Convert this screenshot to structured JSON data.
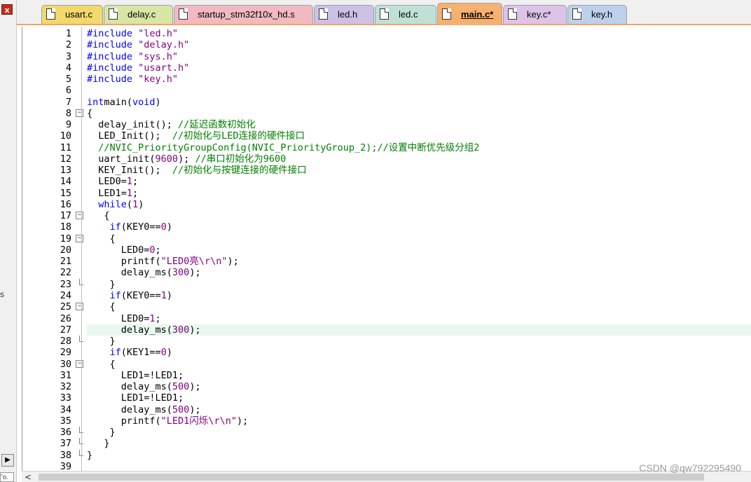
{
  "left_panel": {
    "close_glyph": "x",
    "fragment": "s",
    "scroll_button": "▶",
    "bottom_fragment": "ˆo."
  },
  "tabs": [
    {
      "label": "usart.c",
      "color": "#f1d96b",
      "active": false
    },
    {
      "label": "delay.c",
      "color": "#d7e6a4",
      "active": false
    },
    {
      "label": "startup_stm32f10x_hd.s",
      "color": "#f2b9c3",
      "active": false
    },
    {
      "label": "led.h",
      "color": "#cdc0e6",
      "active": false
    },
    {
      "label": "led.c",
      "color": "#bfe0d6",
      "active": false
    },
    {
      "label": "main.c*",
      "color": "#f6b070",
      "active": true
    },
    {
      "label": "key.c*",
      "color": "#ddc3e8",
      "active": false
    },
    {
      "label": "key.h",
      "color": "#bdd0ec",
      "active": false
    }
  ],
  "editor": {
    "current_line": 27,
    "lines": [
      {
        "n": "1",
        "fold": "",
        "t": [
          [
            "pp",
            "#include "
          ],
          [
            "str",
            "\"led.h\""
          ]
        ]
      },
      {
        "n": "2",
        "fold": "",
        "t": [
          [
            "pp",
            "#include "
          ],
          [
            "str",
            "\"delay.h\""
          ]
        ]
      },
      {
        "n": "3",
        "fold": "",
        "t": [
          [
            "pp",
            "#include "
          ],
          [
            "str",
            "\"sys.h\""
          ]
        ]
      },
      {
        "n": "4",
        "fold": "",
        "t": [
          [
            "pp",
            "#include "
          ],
          [
            "str",
            "\"usart.h\""
          ]
        ]
      },
      {
        "n": "5",
        "fold": "",
        "t": [
          [
            "pp",
            "#include "
          ],
          [
            "str",
            "\"key.h\""
          ]
        ]
      },
      {
        "n": "6",
        "fold": "",
        "t": []
      },
      {
        "n": "7",
        "fold": "",
        "t": [
          [
            "kw",
            "int"
          ],
          [
            "",
            "main("
          ],
          [
            "kw",
            "void"
          ],
          [
            "",
            ")"
          ]
        ]
      },
      {
        "n": "8",
        "fold": "open",
        "t": [
          [
            "",
            "{"
          ]
        ]
      },
      {
        "n": "9",
        "fold": "",
        "t": [
          [
            "",
            "  delay_init(); "
          ],
          [
            "cmt",
            "//延迟函数初始化"
          ]
        ]
      },
      {
        "n": "10",
        "fold": "",
        "t": [
          [
            "",
            "  LED_Init();  "
          ],
          [
            "cmt",
            "//初始化与LED连接的硬件接口"
          ]
        ]
      },
      {
        "n": "11",
        "fold": "",
        "t": [
          [
            "cmt",
            "  //NVIC_PriorityGroupConfig(NVIC_PriorityGroup_2);//设置中断优先级分组2"
          ]
        ]
      },
      {
        "n": "12",
        "fold": "",
        "t": [
          [
            "",
            "  uart_init("
          ],
          [
            "num",
            "9600"
          ],
          [
            "",
            "); "
          ],
          [
            "cmt",
            "//串口初始化为9600"
          ]
        ]
      },
      {
        "n": "13",
        "fold": "",
        "t": [
          [
            "",
            "  KEY_Init();  "
          ],
          [
            "cmt",
            "//初始化与按键连接的硬件接口"
          ]
        ]
      },
      {
        "n": "14",
        "fold": "",
        "t": [
          [
            "",
            "  LED0="
          ],
          [
            "num",
            "1"
          ],
          [
            "",
            ";"
          ]
        ]
      },
      {
        "n": "15",
        "fold": "",
        "t": [
          [
            "",
            "  LED1="
          ],
          [
            "num",
            "1"
          ],
          [
            "",
            ";"
          ]
        ]
      },
      {
        "n": "16",
        "fold": "",
        "t": [
          [
            "",
            "  "
          ],
          [
            "kw",
            "while"
          ],
          [
            "",
            "("
          ],
          [
            "num",
            "1"
          ],
          [
            "",
            ")"
          ]
        ]
      },
      {
        "n": "17",
        "fold": "open",
        "t": [
          [
            "",
            "   {"
          ]
        ]
      },
      {
        "n": "18",
        "fold": "",
        "t": [
          [
            "",
            "    "
          ],
          [
            "kw",
            "if"
          ],
          [
            "",
            "(KEY0=="
          ],
          [
            "num",
            "0"
          ],
          [
            "",
            ")"
          ]
        ]
      },
      {
        "n": "19",
        "fold": "open",
        "t": [
          [
            "",
            "    {"
          ]
        ]
      },
      {
        "n": "20",
        "fold": "",
        "t": [
          [
            "",
            "      LED0="
          ],
          [
            "num",
            "0"
          ],
          [
            "",
            ";"
          ]
        ]
      },
      {
        "n": "21",
        "fold": "",
        "t": [
          [
            "",
            "      printf("
          ],
          [
            "str",
            "\"LED0亮\\r\\n\""
          ],
          [
            "",
            ");"
          ]
        ]
      },
      {
        "n": "22",
        "fold": "",
        "t": [
          [
            "",
            "      delay_ms("
          ],
          [
            "num",
            "300"
          ],
          [
            "",
            ");"
          ]
        ]
      },
      {
        "n": "23",
        "fold": "end",
        "t": [
          [
            "",
            "    }"
          ]
        ]
      },
      {
        "n": "24",
        "fold": "",
        "t": [
          [
            "",
            "    "
          ],
          [
            "kw",
            "if"
          ],
          [
            "",
            "(KEY0=="
          ],
          [
            "num",
            "1"
          ],
          [
            "",
            ")"
          ]
        ]
      },
      {
        "n": "25",
        "fold": "open",
        "t": [
          [
            "",
            "    {"
          ]
        ]
      },
      {
        "n": "26",
        "fold": "",
        "t": [
          [
            "",
            "      LED0="
          ],
          [
            "num",
            "1"
          ],
          [
            "",
            ";"
          ]
        ]
      },
      {
        "n": "27",
        "fold": "",
        "t": [
          [
            "",
            "      delay_ms("
          ],
          [
            "num",
            "300"
          ],
          [
            "",
            ");"
          ]
        ]
      },
      {
        "n": "28",
        "fold": "end",
        "t": [
          [
            "",
            "    }"
          ]
        ]
      },
      {
        "n": "29",
        "fold": "",
        "t": [
          [
            "",
            "    "
          ],
          [
            "kw",
            "if"
          ],
          [
            "",
            "(KEY1=="
          ],
          [
            "num",
            "0"
          ],
          [
            "",
            ")"
          ]
        ]
      },
      {
        "n": "30",
        "fold": "open",
        "t": [
          [
            "",
            "    {"
          ]
        ]
      },
      {
        "n": "31",
        "fold": "",
        "t": [
          [
            "",
            "      LED1=!LED1;"
          ]
        ]
      },
      {
        "n": "32",
        "fold": "",
        "t": [
          [
            "",
            "      delay_ms("
          ],
          [
            "num",
            "500"
          ],
          [
            "",
            ");"
          ]
        ]
      },
      {
        "n": "33",
        "fold": "",
        "t": [
          [
            "",
            "      LED1=!LED1;"
          ]
        ]
      },
      {
        "n": "34",
        "fold": "",
        "t": [
          [
            "",
            "      delay_ms("
          ],
          [
            "num",
            "500"
          ],
          [
            "",
            ");"
          ]
        ]
      },
      {
        "n": "35",
        "fold": "",
        "t": [
          [
            "",
            "      printf("
          ],
          [
            "str",
            "\"LED1闪烁\\r\\n\""
          ],
          [
            "",
            ");"
          ]
        ]
      },
      {
        "n": "36",
        "fold": "end",
        "t": [
          [
            "",
            "    }"
          ]
        ]
      },
      {
        "n": "37",
        "fold": "end",
        "t": [
          [
            "",
            "   }"
          ]
        ]
      },
      {
        "n": "38",
        "fold": "end",
        "t": [
          [
            "",
            "}"
          ]
        ]
      },
      {
        "n": "39",
        "fold": "",
        "t": []
      }
    ]
  },
  "scrollbar": {
    "left_arrow": "<"
  },
  "watermark": "CSDN @qw792295490"
}
